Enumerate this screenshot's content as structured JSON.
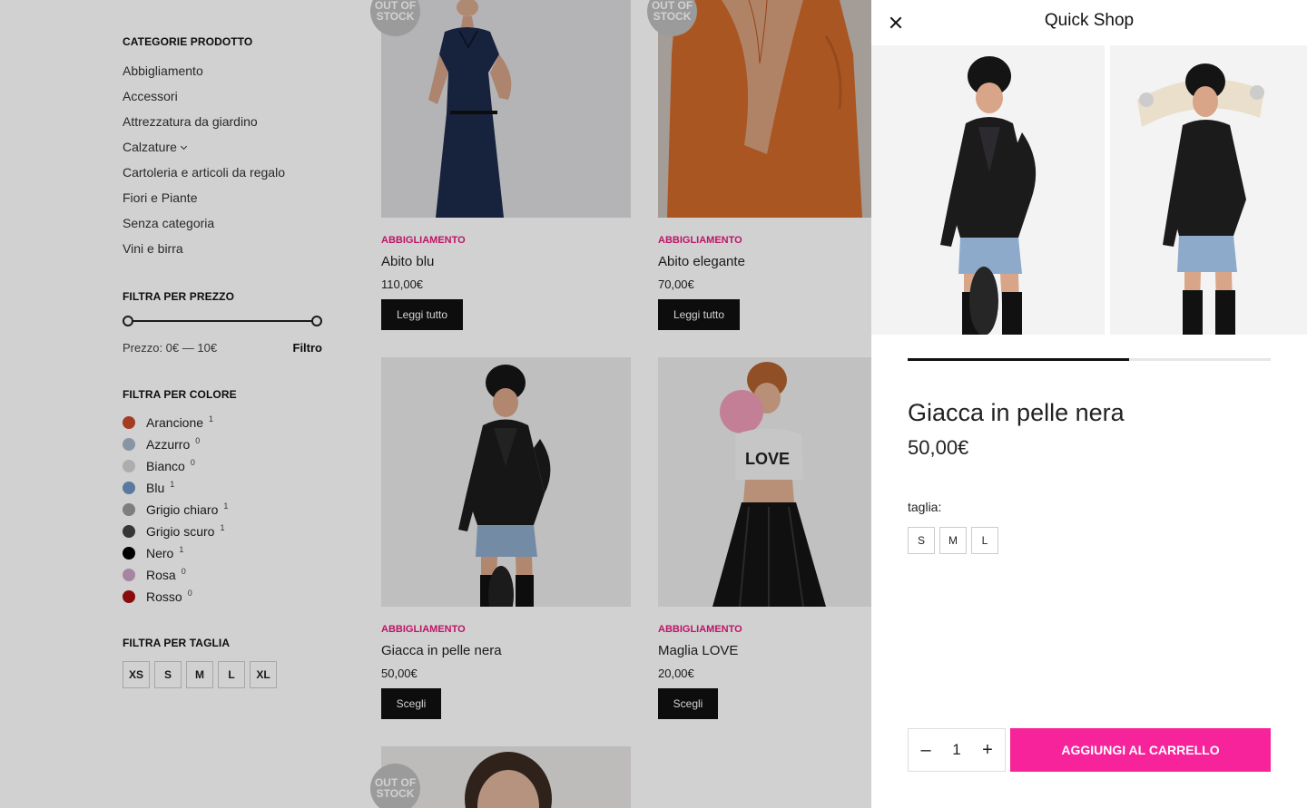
{
  "sidebar": {
    "categories_title": "CATEGORIE PRODOTTO",
    "categories": [
      {
        "label": "Abbigliamento"
      },
      {
        "label": "Accessori"
      },
      {
        "label": "Attrezzatura da giardino"
      },
      {
        "label": "Calzature",
        "has_children": true
      },
      {
        "label": "Cartoleria e articoli da regalo"
      },
      {
        "label": "Fiori e Piante"
      },
      {
        "label": "Senza categoria"
      },
      {
        "label": "Vini e birra"
      }
    ],
    "price": {
      "title": "FILTRA PER PREZZO",
      "label": "Prezzo: 0€ — 10€",
      "filter_button": "Filtro",
      "min": 0,
      "max": 10
    },
    "colors": {
      "title": "FILTRA PER COLORE",
      "items": [
        {
          "label": "Arancione",
          "count": "1",
          "color": "#c9492a"
        },
        {
          "label": "Azzurro",
          "count": "0",
          "color": "#a6b8c7"
        },
        {
          "label": "Bianco",
          "count": "0",
          "color": "#d4d4d4"
        },
        {
          "label": "Blu",
          "count": "1",
          "color": "#6f94c4"
        },
        {
          "label": "Grigio chiaro",
          "count": "1",
          "color": "#9a9a9a"
        },
        {
          "label": "Grigio scuro",
          "count": "1",
          "color": "#444444"
        },
        {
          "label": "Nero",
          "count": "1",
          "color": "#000000"
        },
        {
          "label": "Rosa",
          "count": "0",
          "color": "#caa3c6"
        },
        {
          "label": "Rosso",
          "count": "0",
          "color": "#a80f0f"
        }
      ]
    },
    "sizes": {
      "title": "FILTRA PER TAGLIA",
      "items": [
        "XS",
        "S",
        "M",
        "L",
        "XL"
      ]
    }
  },
  "products": [
    {
      "category": "ABBIGLIAMENTO",
      "title": "Abito blu",
      "price": "110,00€",
      "button": "Leggi tutto",
      "badge": "OUT OF STOCK"
    },
    {
      "category": "ABBIGLIAMENTO",
      "title": "Abito elegante",
      "price": "70,00€",
      "button": "Leggi tutto",
      "badge": "OUT OF STOCK"
    },
    {
      "category": "ABBIGLIAMENTO",
      "title": "Giacca in pelle nera",
      "price": "50,00€",
      "button": "Scegli"
    },
    {
      "category": "ABBIGLIAMENTO",
      "title": "Maglia LOVE",
      "price": "20,00€",
      "button": "Scegli"
    },
    {
      "badge": "OUT OF STOCK"
    }
  ],
  "quick_shop": {
    "title": "Quick Shop",
    "product_title": "Giacca in pelle nera",
    "price": "50,00€",
    "size_label": "taglia:",
    "sizes": [
      "S",
      "M",
      "L"
    ],
    "quantity": "1",
    "add_to_cart": "AGGIUNGI AL CARRELLO",
    "gallery_progress": 0.61
  },
  "colors": {
    "accent_pink": "#f6239a",
    "category_pink": "#e8197d"
  }
}
